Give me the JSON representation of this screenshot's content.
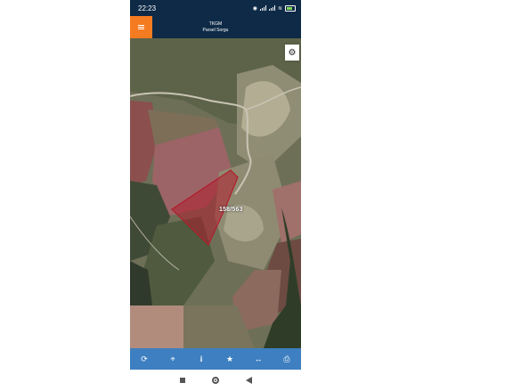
{
  "status_bar": {
    "time": "22:23",
    "battery_icon": "battery-icon",
    "wifi_icon": "wifi-icon",
    "signal_icon": "signal-icon"
  },
  "app_bar": {
    "title": "TKGM",
    "subtitle": "Parsel Sorgu",
    "menu_icon": "menu-icon"
  },
  "map": {
    "parcel_label": "158/563",
    "settings_icon": "gear-icon",
    "parcel_color": "#b01e2e"
  },
  "toolbar": {
    "color": "#3d7fc1",
    "items": [
      {
        "icon": "refresh-icon",
        "glyph": "⟳"
      },
      {
        "icon": "locate-icon",
        "glyph": "⌖"
      },
      {
        "icon": "info-icon",
        "glyph": "i"
      },
      {
        "icon": "star-icon",
        "glyph": "★"
      },
      {
        "icon": "measure-icon",
        "glyph": "↔"
      },
      {
        "icon": "print-icon",
        "glyph": "⎙"
      }
    ]
  },
  "nav": {
    "recent_icon": "square-icon",
    "home_icon": "home-circle-icon",
    "back_icon": "back-triangle-icon"
  }
}
